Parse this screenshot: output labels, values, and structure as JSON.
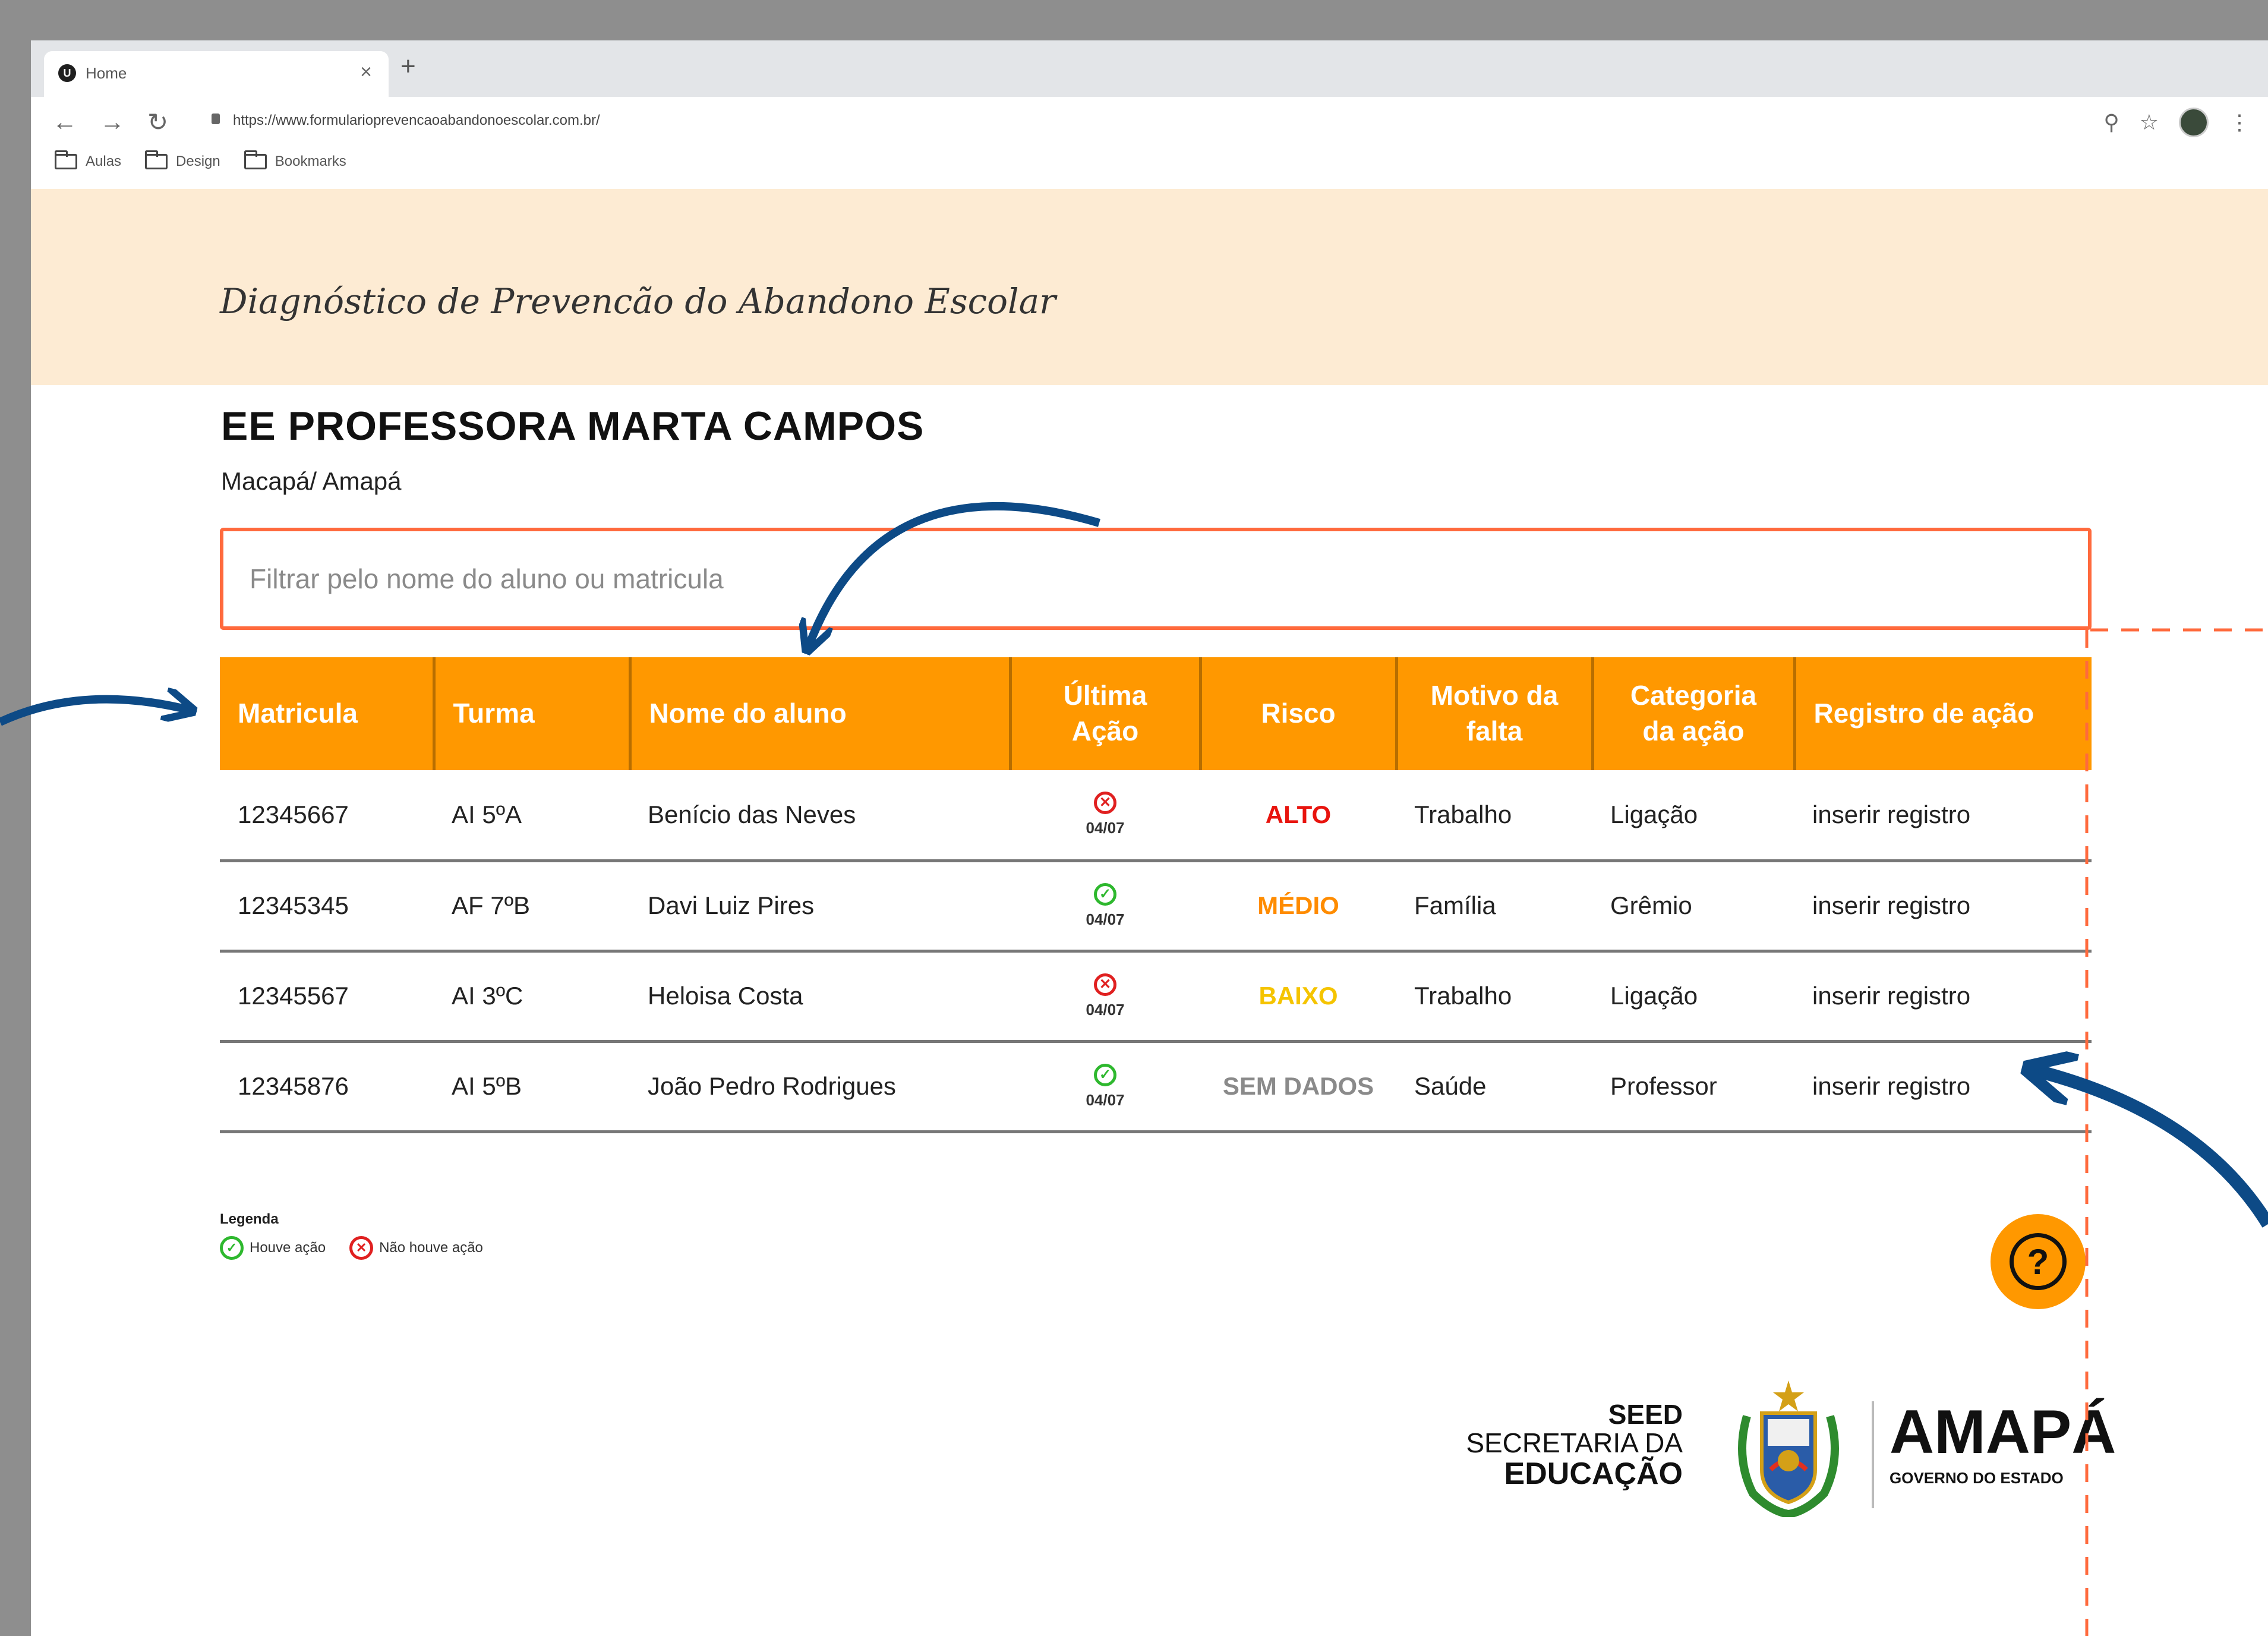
{
  "browser": {
    "tab_title": "Home",
    "tab_close": "×",
    "new_tab": "+",
    "url": "https://www.formularioprevencaoabandonoescolar.com.br/",
    "bookmarks": [
      "Aulas",
      "Design",
      "Bookmarks"
    ]
  },
  "app": {
    "title": "Diagnóstico de Prevencão do Abandono Escolar"
  },
  "school": {
    "name": "EE PROFESSORA MARTA CAMPOS",
    "city": "Macapá/ Amapá"
  },
  "search": {
    "placeholder": "Filtrar pelo nome do aluno ou matricula"
  },
  "table": {
    "headers": [
      "Matricula",
      "Turma",
      "Nome do aluno",
      "Última Ação",
      "Risco",
      "Motivo da falta",
      "Categoria da ação",
      "Registro de ação"
    ],
    "rows": [
      {
        "matricula": "12345667",
        "turma": "AI 5ºA",
        "nome": "Benício das Neves",
        "acao_status": "nao",
        "acao_data": "04/07",
        "risco": "ALTO",
        "risco_color": "#e8140e",
        "motivo": "Trabalho",
        "categoria": "Ligação",
        "registro": "inserir registro"
      },
      {
        "matricula": "12345345",
        "turma": "AF 7ºB",
        "nome": "Davi Luiz Pires",
        "acao_status": "sim",
        "acao_data": "04/07",
        "risco": "MÉDIO",
        "risco_color": "#ff8c00",
        "motivo": "Família",
        "categoria": "Grêmio",
        "registro": "inserir registro"
      },
      {
        "matricula": "12345567",
        "turma": "AI 3ºC",
        "nome": "Heloisa Costa",
        "acao_status": "nao",
        "acao_data": "04/07",
        "risco": "BAIXO",
        "risco_color": "#f5c400",
        "motivo": "Trabalho",
        "categoria": "Ligação",
        "registro": "inserir registro"
      },
      {
        "matricula": "12345876",
        "turma": "AI 5ºB",
        "nome": "João Pedro Rodrigues",
        "acao_status": "sim",
        "acao_data": "04/07",
        "risco": "SEM DADOS",
        "risco_color": "#8a8a8a",
        "motivo": "Saúde",
        "categoria": "Professor",
        "registro": "inserir registro"
      }
    ]
  },
  "legend": {
    "title": "Legenda",
    "items": [
      {
        "icon": "check-circle-icon",
        "label": "Houve ação"
      },
      {
        "icon": "x-circle-icon",
        "label": "Não houve ação"
      }
    ]
  },
  "help": {
    "symbol": "?"
  },
  "footer": {
    "seed_line1": "SEED",
    "seed_line2": "SECRETARIA DA",
    "seed_line3": "EDUCAÇÃO",
    "state_name": "AMAPÁ",
    "state_sub": "GOVERNO DO ESTADO"
  },
  "colors": {
    "accent": "#ff9800",
    "header_bg": "#fdebd3",
    "search_border": "#ff6a3d",
    "ok": "#2eb82e",
    "no": "#e02020",
    "annotation_arrow": "#0d4a86",
    "annotation_dash": "#ff6a3d"
  }
}
